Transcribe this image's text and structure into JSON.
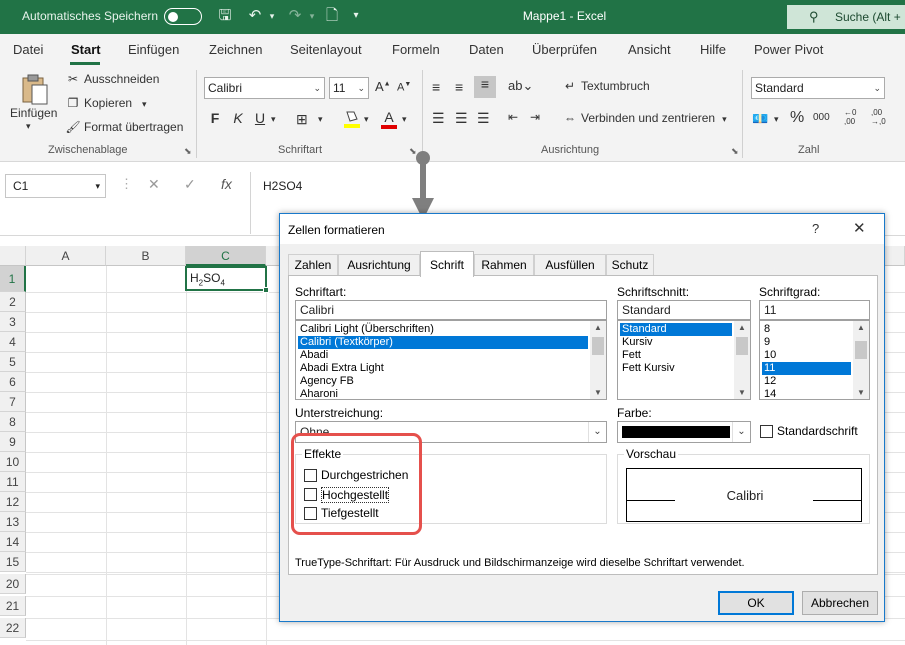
{
  "titlebar": {
    "autosave_label": "Automatisches Speichern",
    "document_title": "Mappe1  -  Excel",
    "search_label": "Suche (Alt +"
  },
  "menu": [
    "Datei",
    "Start",
    "Einfügen",
    "Zeichnen",
    "Seitenlayout",
    "Formeln",
    "Daten",
    "Überprüfen",
    "Ansicht",
    "Hilfe",
    "Power Pivot"
  ],
  "ribbon": {
    "clipboard": {
      "label": "Zwischenablage",
      "paste": "Einfügen",
      "cut": "Ausschneiden",
      "copy": "Kopieren",
      "format_painter": "Format übertragen"
    },
    "font": {
      "label": "Schriftart",
      "font_name": "Calibri",
      "font_size": "11",
      "bold": "F",
      "italic": "K",
      "underline": "U"
    },
    "alignment": {
      "label": "Ausrichtung",
      "wrap_text": "Textumbruch",
      "merge_center": "Verbinden und zentrieren"
    },
    "number": {
      "label": "Zahl",
      "format": "Standard"
    }
  },
  "formula_bar": {
    "name_box": "C1",
    "formula": "H2SO4",
    "fx": "fx"
  },
  "grid": {
    "columns": [
      "A",
      "B",
      "C"
    ],
    "rows": [
      "1",
      "2",
      "3",
      "4",
      "5",
      "6",
      "7",
      "8",
      "9",
      "10",
      "11",
      "12",
      "13",
      "14",
      "15",
      "20",
      "21",
      "22"
    ],
    "cell_c1": {
      "base": "H",
      "sub1": "2",
      "mid": "SO",
      "sub2": "4"
    }
  },
  "dialog": {
    "title": "Zellen formatieren",
    "help": "?",
    "close": "✕",
    "tabs": [
      "Zahlen",
      "Ausrichtung",
      "Schrift",
      "Rahmen",
      "Ausfüllen",
      "Schutz"
    ],
    "active_tab": "Schrift",
    "font_label": "Schriftart:",
    "font_value": "Calibri",
    "font_list": [
      "Calibri Light (Überschriften)",
      "Calibri (Textkörper)",
      "Abadi",
      "Abadi Extra Light",
      "Agency FB",
      "Aharoni"
    ],
    "style_label": "Schriftschnitt:",
    "style_value": "Standard",
    "style_list": [
      "Standard",
      "Kursiv",
      "Fett",
      "Fett Kursiv"
    ],
    "size_label": "Schriftgrad:",
    "size_value": "11",
    "size_list": [
      "8",
      "9",
      "10",
      "11",
      "12",
      "14"
    ],
    "underline_label": "Unterstreichung:",
    "underline_value": "Ohne",
    "color_label": "Farbe:",
    "color_value": "#000000",
    "standard_font_label": "Standardschrift",
    "effects_label": "Effekte",
    "effects": [
      "Durchgestrichen",
      "Hochgestellt",
      "Tiefgestellt"
    ],
    "preview_label": "Vorschau",
    "preview_text": "Calibri",
    "info_text": "TrueType-Schriftart: Für Ausdruck und Bildschirmanzeige wird dieselbe Schriftart verwendet.",
    "ok": "OK",
    "cancel": "Abbrechen"
  },
  "colors": {
    "excel_green": "#217346",
    "selection_blue": "#0078d7",
    "highlight_red": "#e5504c"
  }
}
